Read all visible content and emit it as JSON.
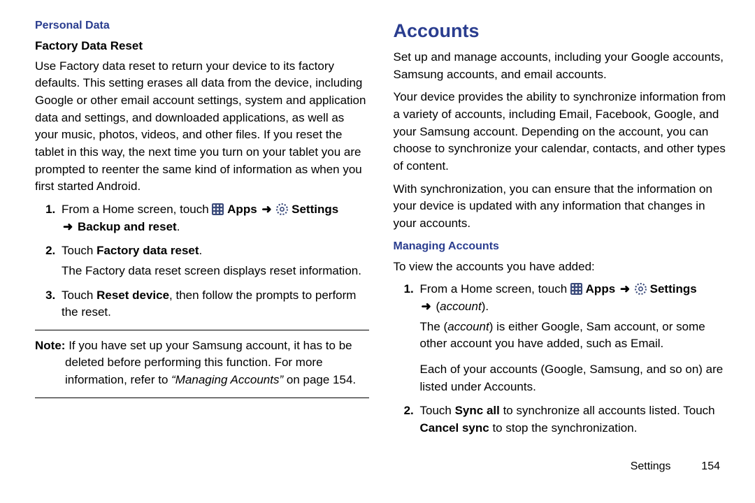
{
  "left": {
    "blueHead": "Personal Data",
    "blackHead": "Factory Data Reset",
    "intro": "Use Factory data reset to return your device to its factory defaults. This setting erases all data from the device, including Google or other email account settings, system and application data and settings, and downloaded applications, as well as your music, photos, videos, and other files. If you reset the tablet in this way, the next time you turn on your tablet you are prompted to reenter the same kind of information as when you first started Android.",
    "steps": [
      {
        "pre": "From a Home screen, touch ",
        "apps": "Apps",
        "settings": "Settings",
        "tail_bold": "Backup and reset",
        "sub": ""
      },
      {
        "pre": "Touch ",
        "bold": "Factory data reset",
        "post": ".",
        "sub": "The Factory data reset screen displays reset information."
      },
      {
        "pre": "Touch ",
        "bold": "Reset device",
        "post": ", then follow the prompts to perform the reset."
      }
    ],
    "noteLabel": "Note:",
    "noteBody": "If you have set up your Samsung account, it has to be deleted before performing this function. For more information, refer to ",
    "noteRefItalic": "“Managing Accounts”",
    "noteRefTail": " on page 154."
  },
  "right": {
    "sectionTitle": "Accounts",
    "p1": "Set up and manage accounts, including your Google accounts, Samsung accounts, and email accounts.",
    "p2": "Your device provides the ability to synchronize information from a variety of accounts, including Email, Facebook, Google, and your Samsung account. Depending on the account, you can choose to synchronize your calendar, contacts, and other types of content.",
    "p3": "With synchronization, you can ensure that the information on your device is updated with any information that changes in your accounts.",
    "blueHead2": "Managing Accounts",
    "lead2": "To view the accounts you have added:",
    "steps": [
      {
        "pre": "From a Home screen, touch ",
        "apps": "Apps",
        "settings": "Settings",
        "tail_italic": "account",
        "sub1_pre": "The (",
        "sub1_italic": "account",
        "sub1_post": ") is either Google, Sam account, or some other account you have added, such as Email.",
        "sub2": "Each of your accounts (Google, Samsung, and so on) are listed under Accounts."
      },
      {
        "pre": "Touch ",
        "bold1": "Sync all",
        "mid": " to synchronize all accounts listed. Touch ",
        "bold2": "Cancel sync",
        "post": " to stop the synchronization."
      }
    ]
  },
  "footer": {
    "section": "Settings",
    "page": "154"
  },
  "glyph": {
    "arrow": "➜"
  }
}
